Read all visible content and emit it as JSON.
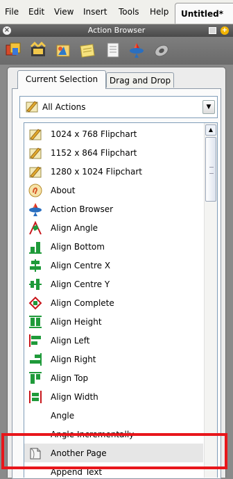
{
  "menubar": {
    "items": [
      "File",
      "Edit",
      "View",
      "Insert",
      "Tools",
      "Help"
    ],
    "document_tab": "Untitled*"
  },
  "titlebar": {
    "title": "Action Browser"
  },
  "toolbar": {
    "icons": [
      "flipchart-resources-icon",
      "animation-icon",
      "shapes-icon",
      "notes-icon",
      "properties-icon",
      "action-browser-icon",
      "add-ins-icon"
    ]
  },
  "tabs": {
    "current_selection": "Current Selection",
    "drag_and_drop": "Drag and Drop"
  },
  "dropdown": {
    "selected": "All Actions",
    "icon": "actions-icon"
  },
  "actions": [
    {
      "label": "1024 x 768 Flipchart",
      "icon": "flipchart-icon"
    },
    {
      "label": "1152 x 864 Flipchart",
      "icon": "flipchart-icon"
    },
    {
      "label": "1280 x 1024 Flipchart",
      "icon": "flipchart-icon"
    },
    {
      "label": "About",
      "icon": "about-icon"
    },
    {
      "label": "Action Browser",
      "icon": "action-browser-icon"
    },
    {
      "label": "Align Angle",
      "icon": "align-angle-icon"
    },
    {
      "label": "Align Bottom",
      "icon": "align-bottom-icon"
    },
    {
      "label": "Align Centre X",
      "icon": "align-centre-x-icon"
    },
    {
      "label": "Align Centre Y",
      "icon": "align-centre-y-icon"
    },
    {
      "label": "Align Complete",
      "icon": "align-complete-icon"
    },
    {
      "label": "Align Height",
      "icon": "align-height-icon"
    },
    {
      "label": "Align Left",
      "icon": "align-left-icon"
    },
    {
      "label": "Align Right",
      "icon": "align-right-icon"
    },
    {
      "label": "Align Top",
      "icon": "align-top-icon"
    },
    {
      "label": "Align Width",
      "icon": "align-width-icon"
    },
    {
      "label": "Angle",
      "icon": ""
    },
    {
      "label": "Angle Incrementally",
      "icon": ""
    },
    {
      "label": "Another Page",
      "icon": "another-page-icon"
    },
    {
      "label": "Append Text",
      "icon": ""
    }
  ],
  "selected_index": 17,
  "colors": {
    "highlight_border": "#e8161b",
    "align_green": "#1f9a3a",
    "align_red": "#c8161b"
  }
}
